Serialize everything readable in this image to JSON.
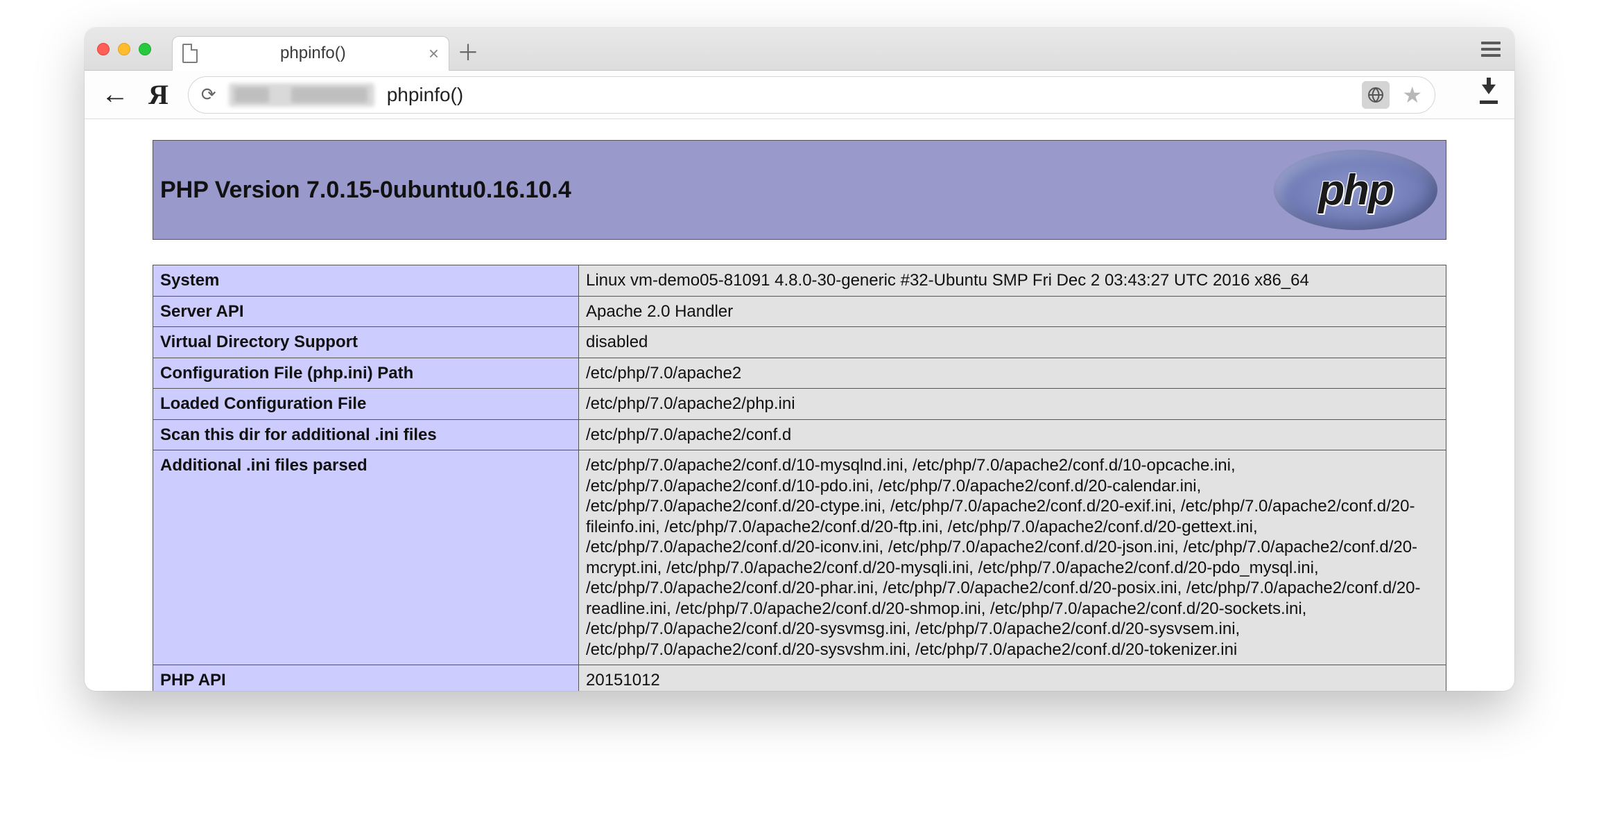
{
  "browser": {
    "tab": {
      "title": "phpinfo()"
    },
    "omnibox": {
      "text": "phpinfo()"
    }
  },
  "phpinfo": {
    "header": "PHP Version 7.0.15-0ubuntu0.16.10.4",
    "logo_text": "php",
    "rows": [
      {
        "k": "System",
        "v": "Linux vm-demo05-81091 4.8.0-30-generic #32-Ubuntu SMP Fri Dec 2 03:43:27 UTC 2016 x86_64"
      },
      {
        "k": "Server API",
        "v": "Apache 2.0 Handler"
      },
      {
        "k": "Virtual Directory Support",
        "v": "disabled"
      },
      {
        "k": "Configuration File (php.ini) Path",
        "v": "/etc/php/7.0/apache2"
      },
      {
        "k": "Loaded Configuration File",
        "v": "/etc/php/7.0/apache2/php.ini"
      },
      {
        "k": "Scan this dir for additional .ini files",
        "v": "/etc/php/7.0/apache2/conf.d"
      },
      {
        "k": "Additional .ini files parsed",
        "v": "/etc/php/7.0/apache2/conf.d/10-mysqlnd.ini, /etc/php/7.0/apache2/conf.d/10-opcache.ini, /etc/php/7.0/apache2/conf.d/10-pdo.ini, /etc/php/7.0/apache2/conf.d/20-calendar.ini, /etc/php/7.0/apache2/conf.d/20-ctype.ini, /etc/php/7.0/apache2/conf.d/20-exif.ini, /etc/php/7.0/apache2/conf.d/20-fileinfo.ini, /etc/php/7.0/apache2/conf.d/20-ftp.ini, /etc/php/7.0/apache2/conf.d/20-gettext.ini, /etc/php/7.0/apache2/conf.d/20-iconv.ini, /etc/php/7.0/apache2/conf.d/20-json.ini, /etc/php/7.0/apache2/conf.d/20-mcrypt.ini, /etc/php/7.0/apache2/conf.d/20-mysqli.ini, /etc/php/7.0/apache2/conf.d/20-pdo_mysql.ini, /etc/php/7.0/apache2/conf.d/20-phar.ini, /etc/php/7.0/apache2/conf.d/20-posix.ini, /etc/php/7.0/apache2/conf.d/20-readline.ini, /etc/php/7.0/apache2/conf.d/20-shmop.ini, /etc/php/7.0/apache2/conf.d/20-sockets.ini, /etc/php/7.0/apache2/conf.d/20-sysvmsg.ini, /etc/php/7.0/apache2/conf.d/20-sysvsem.ini, /etc/php/7.0/apache2/conf.d/20-sysvshm.ini, /etc/php/7.0/apache2/conf.d/20-tokenizer.ini"
      },
      {
        "k": "PHP API",
        "v": "20151012"
      }
    ]
  }
}
